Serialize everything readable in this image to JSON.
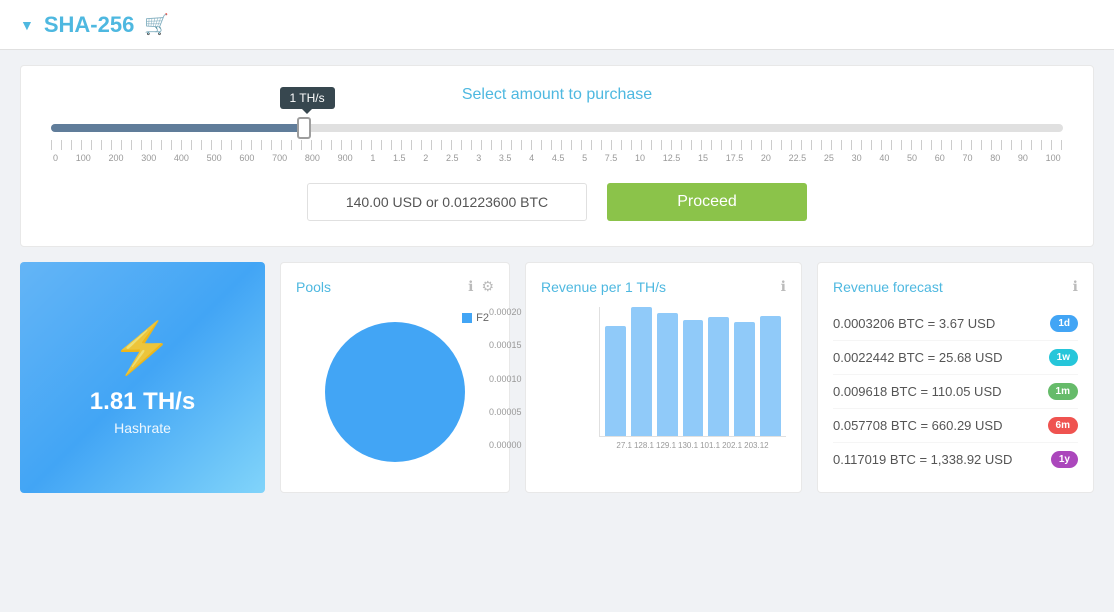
{
  "topbar": {
    "arrow": "▼",
    "title": "SHA-256",
    "cart_icon": "🛒"
  },
  "purchase": {
    "title": "Select amount to purchase",
    "slider_value": "1 TH/s",
    "price_display": "140.00 USD or 0.01223600 BTC",
    "proceed_label": "Proceed",
    "tick_marks": [
      "0",
      "100",
      "200",
      "300",
      "400",
      "500",
      "600",
      "700",
      "800",
      "900",
      "1",
      "1.5",
      "2",
      "2.5",
      "3",
      "3.5",
      "4",
      "4.5",
      "5",
      "7.5",
      "10",
      "12.5",
      "15",
      "17.5",
      "20",
      "22.5",
      "25",
      "30",
      "40",
      "50",
      "60",
      "70",
      "80",
      "90",
      "100"
    ]
  },
  "hashrate": {
    "value": "1.81 TH/s",
    "label": "Hashrate"
  },
  "pools": {
    "title": "Pools",
    "legend": "F2"
  },
  "revenue_per_th": {
    "title": "Revenue per 1 TH/s",
    "y_labels": [
      "0.00020",
      "0.00015",
      "0.00010",
      "0.00005",
      "0.00000"
    ],
    "bars": [
      85,
      100,
      95,
      90,
      92,
      88,
      93
    ],
    "x_labels": [
      "27.1",
      "128.1",
      "129.1",
      "130.1",
      "101.1",
      "202.1",
      "203.12"
    ]
  },
  "revenue_forecast": {
    "title": "Revenue forecast",
    "rows": [
      {
        "value": "0.0003206 BTC = 3.67 USD",
        "badge": "1d",
        "badge_class": "badge-1d"
      },
      {
        "value": "0.0022442 BTC = 25.68 USD",
        "badge": "1w",
        "badge_class": "badge-1w"
      },
      {
        "value": "0.009618 BTC = 110.05 USD",
        "badge": "1m",
        "badge_class": "badge-1m"
      },
      {
        "value": "0.057708 BTC = 660.29 USD",
        "badge": "6m",
        "badge_class": "badge-6m"
      },
      {
        "value": "0.117019 BTC = 1,338.92 USD",
        "badge": "1y",
        "badge_class": "badge-1y"
      }
    ]
  }
}
